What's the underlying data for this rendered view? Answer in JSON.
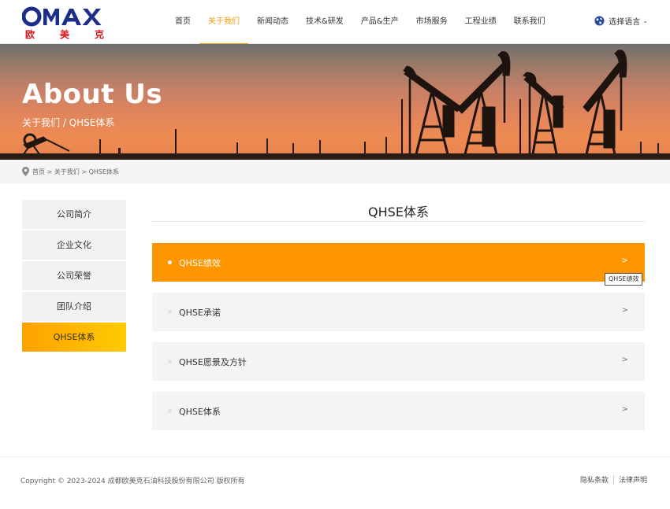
{
  "brand": {
    "logo_word": "OMAX",
    "logo_cn_chars": [
      "欧",
      "美",
      "克"
    ],
    "primary_color": "#1c2e8a",
    "red_color": "#d5141c"
  },
  "nav": {
    "items": [
      {
        "label": "首页",
        "active": false
      },
      {
        "label": "关于我们",
        "active": true
      },
      {
        "label": "新闻动态",
        "active": false
      },
      {
        "label": "技术&研发",
        "active": false
      },
      {
        "label": "产品&生产",
        "active": false
      },
      {
        "label": "市场服务",
        "active": false
      },
      {
        "label": "工程业绩",
        "active": false
      },
      {
        "label": "联系我们",
        "active": false
      }
    ],
    "language_label": "选择语言",
    "accent_color": "#f29b05"
  },
  "banner": {
    "title": "About Us",
    "crumb": "关于我们 / QHSE体系"
  },
  "breadcrumb": {
    "trail": "首页 > 关于我们 > QHSE体系"
  },
  "sidebar": {
    "items": [
      {
        "label": "公司简介",
        "active": false
      },
      {
        "label": "企业文化",
        "active": false
      },
      {
        "label": "公司荣誉",
        "active": false
      },
      {
        "label": "团队介绍",
        "active": false
      },
      {
        "label": "QHSE体系",
        "active": true
      }
    ]
  },
  "main": {
    "title": "QHSE体系",
    "items": [
      {
        "label": "QHSE绩效",
        "active": true,
        "arrow": ">"
      },
      {
        "label": "QHSE承诺",
        "active": false,
        "arrow": ">"
      },
      {
        "label": "QHSE愿景及方针",
        "active": false,
        "arrow": ">"
      },
      {
        "label": "QHSE体系",
        "active": false,
        "arrow": ">"
      }
    ],
    "tooltip": "QHSE绩效"
  },
  "footer": {
    "copyright": "Copyright © 2023-2024 成都欧美克石油科技股份有限公司 版权所有",
    "links": [
      "隐私条款",
      "法律声明"
    ]
  }
}
